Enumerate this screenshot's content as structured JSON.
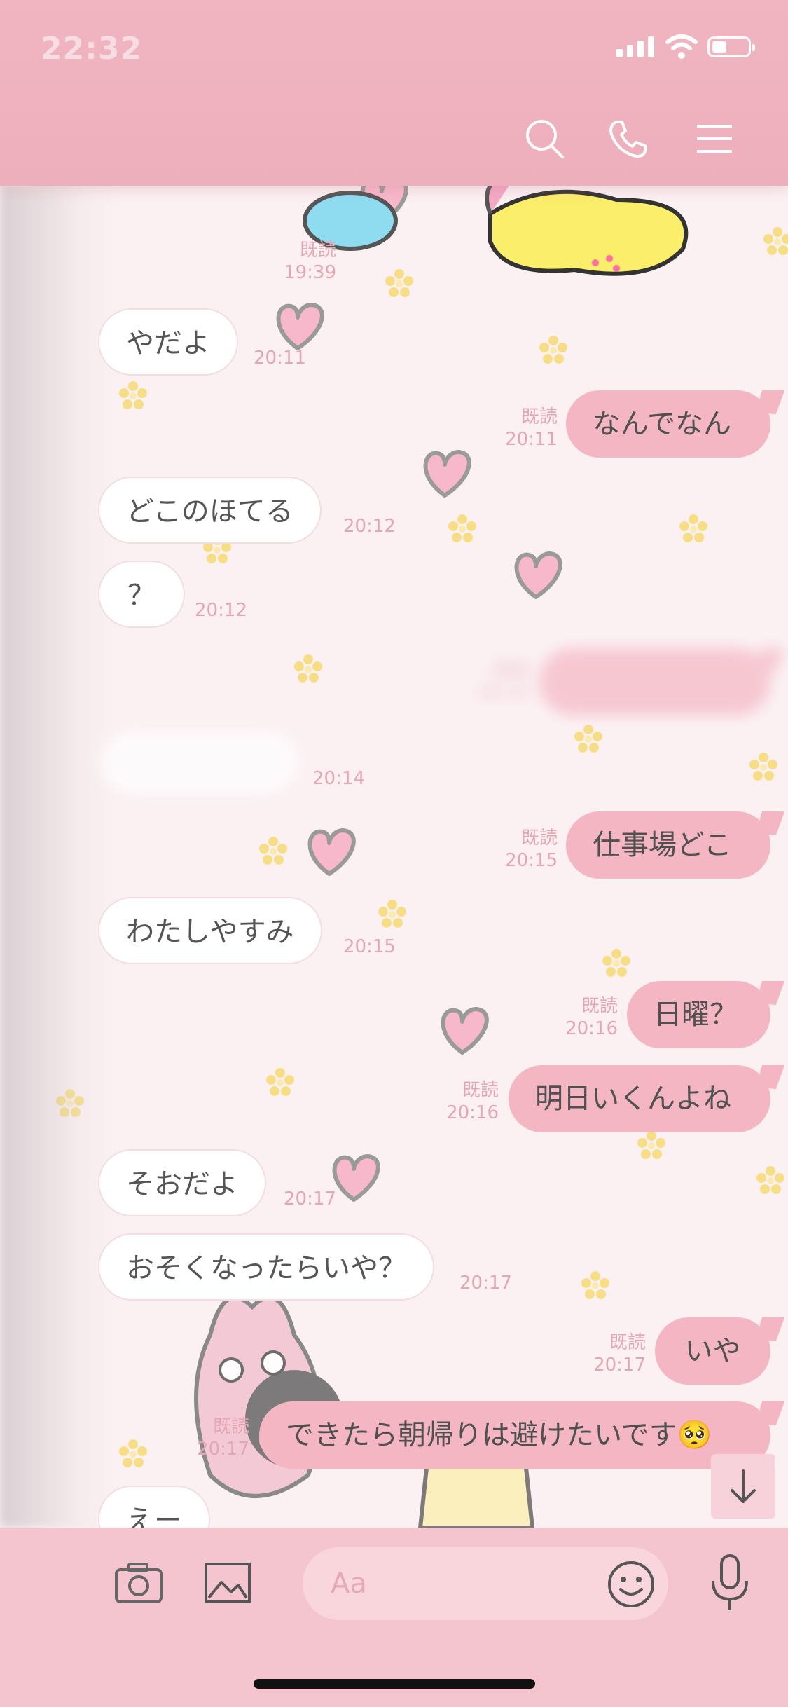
{
  "status_bar": {
    "time": "22:32"
  },
  "header": {
    "icons": [
      "search-icon",
      "phone-icon",
      "menu-icon"
    ]
  },
  "messages": [
    {
      "side": "out",
      "text": "",
      "read": "既読",
      "time": "19:39"
    },
    {
      "side": "in",
      "text": "やだよ",
      "time": "20:11"
    },
    {
      "side": "out",
      "text": "なんでなん",
      "read": "既読",
      "time": "20:11"
    },
    {
      "side": "in",
      "text": "どこのほてる",
      "time": "20:12"
    },
    {
      "side": "in",
      "text": "？",
      "time": "20:12"
    },
    {
      "side": "out",
      "text": "",
      "read": "既読",
      "time": "20:12",
      "blurred": true
    },
    {
      "side": "in",
      "text": "",
      "time": "20:14",
      "blurred": true
    },
    {
      "side": "out",
      "text": "仕事場どこ",
      "read": "既読",
      "time": "20:15"
    },
    {
      "side": "in",
      "text": "わたしやすみ",
      "time": "20:15"
    },
    {
      "side": "out",
      "text": "日曜？",
      "read": "既読",
      "time": "20:16"
    },
    {
      "side": "out",
      "text": "明日いくんよね",
      "read": "既読",
      "time": "20:16"
    },
    {
      "side": "in",
      "text": "そおだよ",
      "time": "20:17"
    },
    {
      "side": "in",
      "text": "おそくなったらいや？",
      "time": "20:17"
    },
    {
      "side": "out",
      "text": "いや",
      "read": "既読",
      "time": "20:17"
    },
    {
      "side": "out",
      "text": "できたら朝帰りは避けたいです🥺",
      "read": "既読",
      "time": "20:17"
    },
    {
      "side": "in",
      "text": "えー",
      "time": ""
    }
  ],
  "input": {
    "placeholder": "Aa"
  },
  "toolbar_icons": [
    "camera-icon",
    "image-icon",
    "emoji-icon",
    "microphone-icon"
  ],
  "colors": {
    "header": "#efb3bf",
    "outgoing_bubble": "#f5b6c4",
    "incoming_bubble": "#ffffff",
    "timestamp": "#e4a6b4"
  }
}
